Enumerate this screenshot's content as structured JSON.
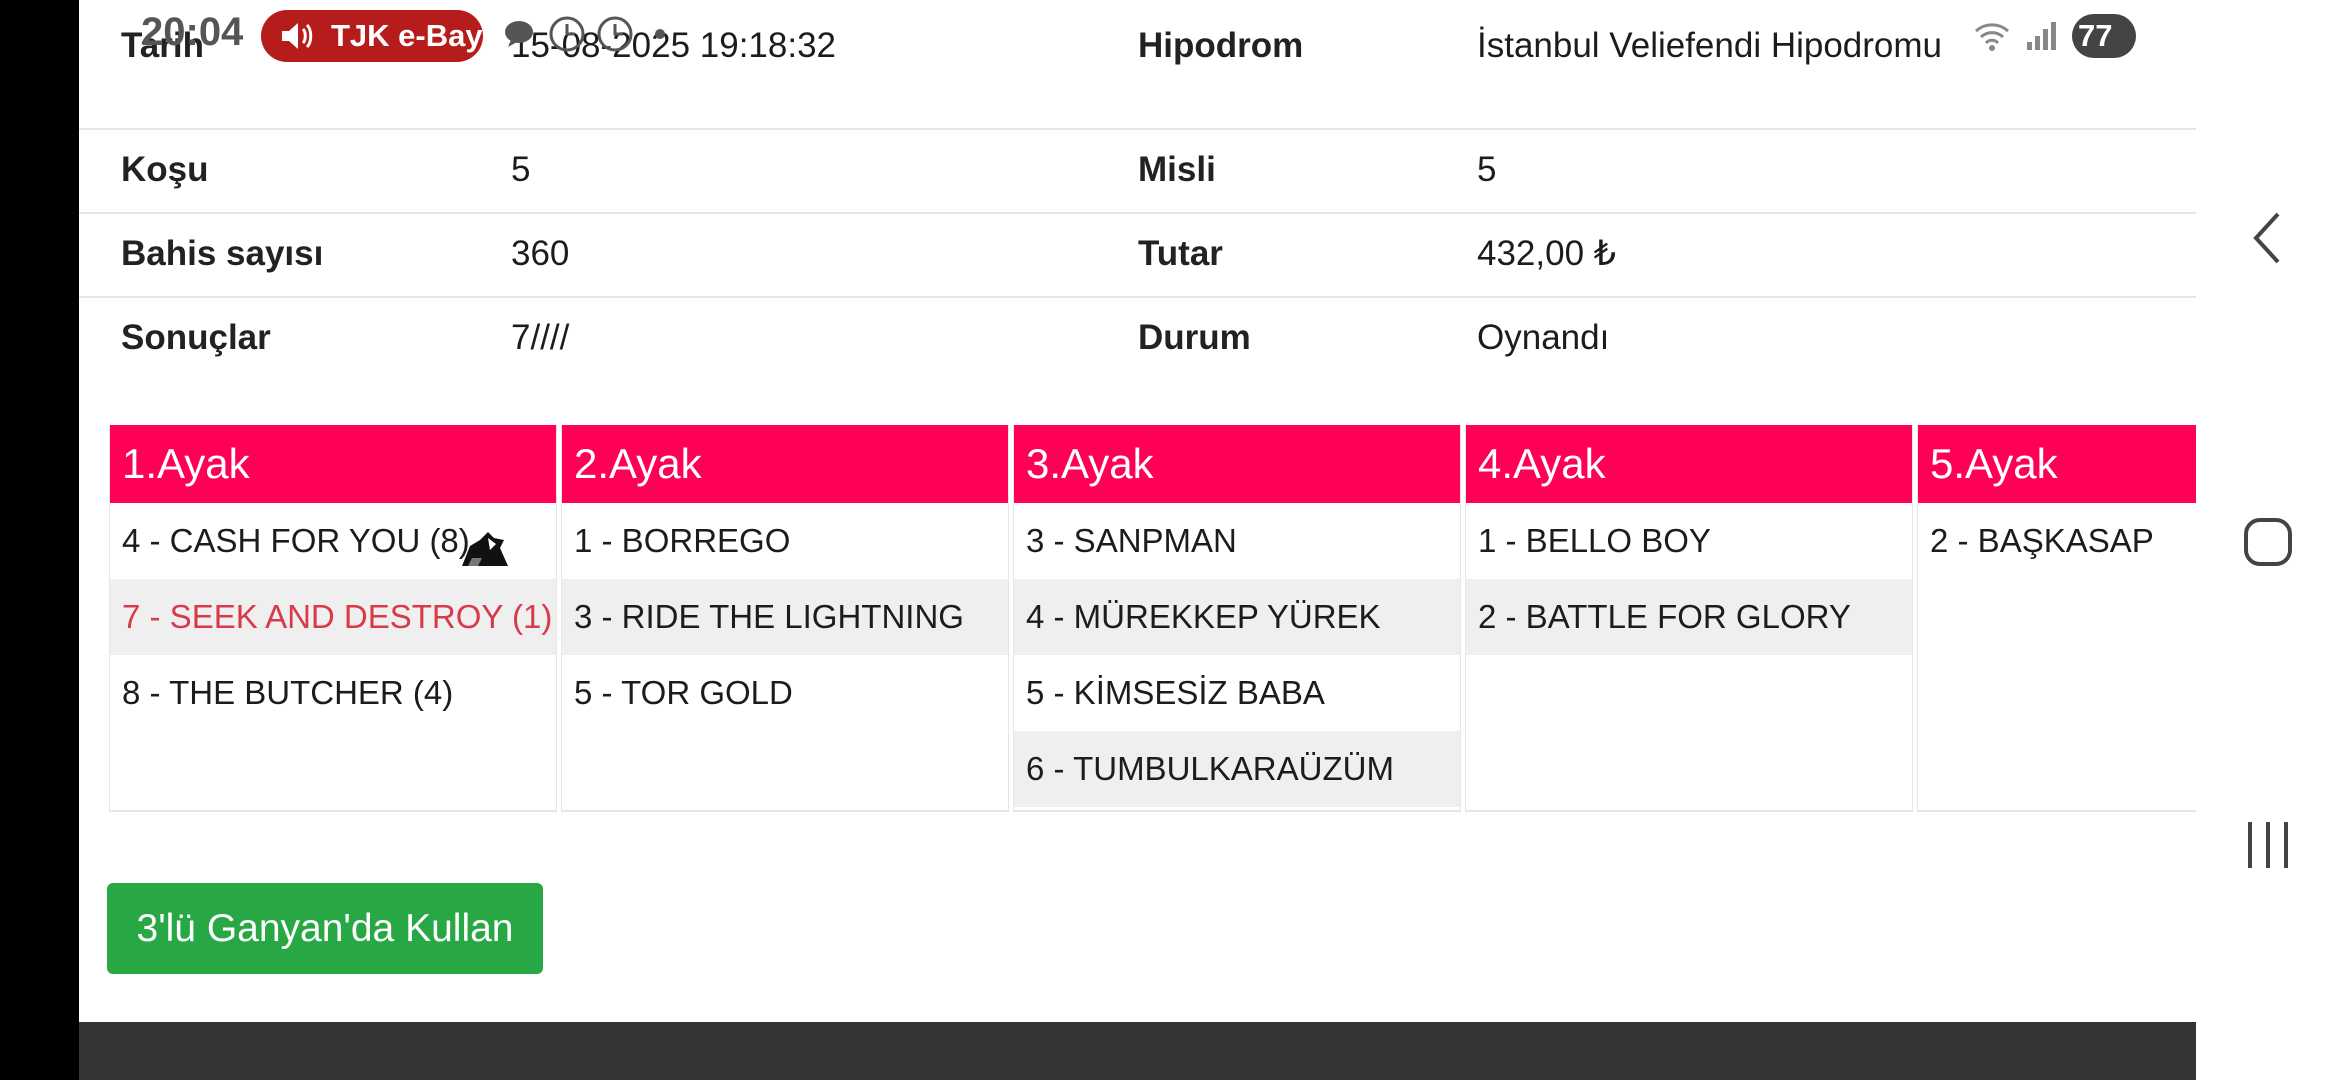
{
  "status_bar": {
    "time": "20:04",
    "pill_text": "TJK e-Bay",
    "battery": "77"
  },
  "info": {
    "rows": [
      {
        "label1": "Tarih",
        "value1": "15-08-2025 19:18:32",
        "label2": "Hipodrom",
        "value2": "İstanbul Veliefendi Hipodromu"
      },
      {
        "label1": "Koşu",
        "value1": "5",
        "label2": "Misli",
        "value2": "5"
      },
      {
        "label1": "Bahis sayısı",
        "value1": "360",
        "label2": "Tutar",
        "value2": "432,00 ₺"
      },
      {
        "label1": "Sonuçlar",
        "value1": "7////",
        "label2": "Durum",
        "value2": "Oynandı"
      }
    ]
  },
  "legs": [
    {
      "title": "1.Ayak",
      "horses": [
        "4 - CASH FOR YOU (8)",
        "7 - SEEK AND DESTROY (1)",
        "8 - THE BUTCHER (4)"
      ]
    },
    {
      "title": "2.Ayak",
      "horses": [
        "1 - BORREGO",
        "3 - RIDE THE LIGHTNING",
        "5 - TOR GOLD"
      ]
    },
    {
      "title": "3.Ayak",
      "horses": [
        "3 - SANPMAN",
        "4 - MÜREKKEP YÜREK",
        "5 - KİMSESİZ BABA",
        "6 - TUMBULKARAÜZÜM"
      ]
    },
    {
      "title": "4.Ayak",
      "horses": [
        "1 - BELLO BOY",
        "2 - BATTLE FOR GLORY"
      ]
    },
    {
      "title": "5.Ayak",
      "horses": [
        "2 - BAŞKASAP"
      ]
    }
  ],
  "action_button": "3'lü Ganyan'da Kullan",
  "colors": {
    "leg_header": "#ff0054",
    "button": "#28a745",
    "winner_text": "#d83a4a"
  },
  "icons": [
    "speaker-icon",
    "chat-bubble-icon",
    "clock-icon",
    "wifi-icon",
    "signal-icon",
    "jockey-silk-icon",
    "back-icon",
    "home-icon",
    "recents-icon"
  ]
}
